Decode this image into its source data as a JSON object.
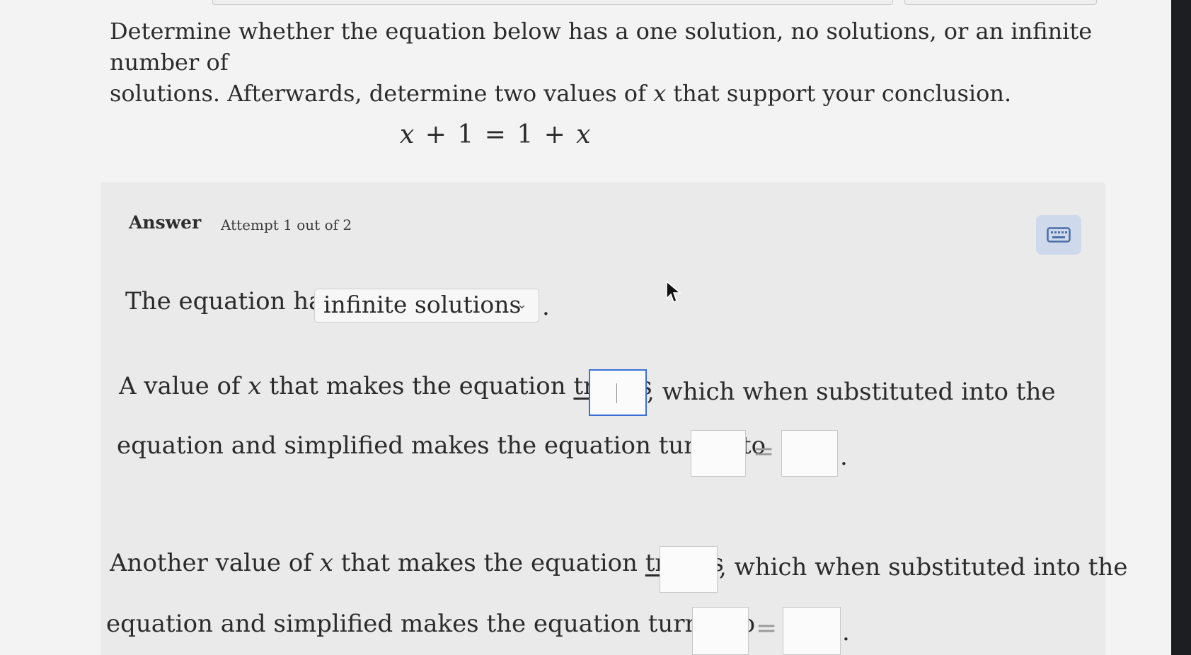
{
  "question": {
    "line1": "Determine whether the equation below has a one solution, no solutions, or an infinite number of",
    "line2_pre": "solutions. Afterwards, determine two values of ",
    "line2_var": "x",
    "line2_post": " that support your conclusion."
  },
  "equation": {
    "lhs_var": "x",
    "lhs_rest": " + 1 = 1 + ",
    "rhs_var": "x"
  },
  "answer": {
    "heading": "Answer",
    "attempt": "Attempt 1 out of 2"
  },
  "line_equation_has": {
    "prefix": "The equation has",
    "dropdown_value": "infinite solutions",
    "suffix": "."
  },
  "first_value": {
    "pre": "A value of ",
    "var": "x",
    "mid": " that makes the equation ",
    "true_word": "true",
    "is": " is",
    "post": ", which when substituted into the",
    "line2": "equation and simplified makes the equation turn into",
    "equals": "=",
    "end": "."
  },
  "second_value": {
    "pre": "Another value of ",
    "var": "x",
    "mid": " that makes the equation ",
    "true_word": "true",
    "is": " is",
    "post": ", which when substituted into the",
    "line2": "equation and simplified makes the equation turn into",
    "equals": "=",
    "end": "."
  },
  "icons": {
    "keyboard": "keyboard-icon",
    "dropdown": "chevron-down-icon",
    "pointer": "mouse-cursor-icon"
  },
  "colors": {
    "focus_border": "#3b6fd8",
    "panel_bg": "#eaeaea",
    "keyboard_button_bg": "#cfd9ec"
  }
}
